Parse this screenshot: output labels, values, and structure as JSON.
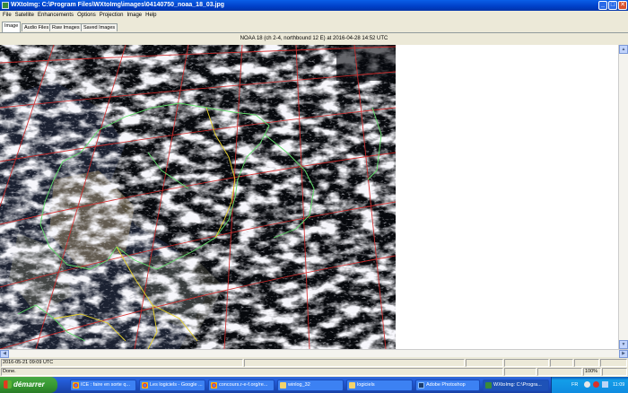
{
  "window": {
    "title": "WXtoImg: C:\\Program Files\\WXtoImg\\images\\04140750_noaa_18_03.jpg",
    "controls": {
      "minimize": "_",
      "maximize": "□",
      "close": "✕"
    }
  },
  "menu": [
    "File",
    "Satellite",
    "Enhancements",
    "Options",
    "Projection",
    "Image",
    "Help"
  ],
  "tabs": [
    {
      "label": "Image",
      "active": true
    },
    {
      "label": "Audio Files",
      "active": false
    },
    {
      "label": "Raw Images",
      "active": false
    },
    {
      "label": "Saved Images",
      "active": false
    }
  ],
  "image": {
    "caption": "NOAA 18 (ch 2-4, northbound 12 E) at 2016-04-28  14:52 UTC"
  },
  "status": {
    "datetime": "2016-05-21  09:09 UTC",
    "message": "Done.",
    "progress": "100%"
  },
  "taskbar": {
    "start_label": "démarrer",
    "tasks": [
      {
        "label": "ICE : faire en sorte q...",
        "icon": "chrome-icon"
      },
      {
        "label": "Les logiciels - Google ...",
        "icon": "chrome-icon"
      },
      {
        "label": "concours.r-e-f.org/re...",
        "icon": "chrome-icon"
      },
      {
        "label": "winlog_32",
        "icon": "folder-icon"
      },
      {
        "label": "logiciels",
        "icon": "folder-icon"
      },
      {
        "label": "Adobe Photoshop",
        "icon": "photoshop-icon"
      },
      {
        "label": "WXtoImg: C:\\Progra...",
        "icon": "wxtoimg-icon"
      }
    ],
    "tray": {
      "lang": "FR",
      "time": "11:09"
    }
  },
  "colors": {
    "titlebar": "#0a5fe8",
    "taskbar": "#245edb",
    "start": "#379a32",
    "grid_lines": "#d42a2a",
    "coastline": "#62e06a",
    "borders": "#e8d22a"
  }
}
